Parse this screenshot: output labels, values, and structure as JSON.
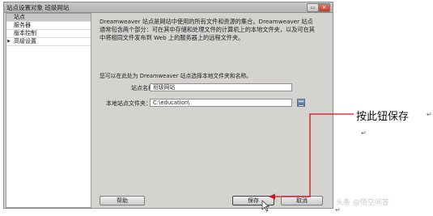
{
  "window": {
    "title": "站点设置对象 班级网站",
    "max_label": "▭",
    "close_label": "✕"
  },
  "sidebar": {
    "items": [
      {
        "label": "站点"
      },
      {
        "label": "服务器"
      },
      {
        "label": "版本控制"
      },
      {
        "label": "高级设置",
        "arrow": "▶"
      }
    ]
  },
  "content": {
    "description": "Dreamweaver 站点是网站中使用的所有文件和资源的集合。Dreamweaver 站点通常包含两个部分：可在其中存储和处理文件的计算机上的本地文件夹，以及可在其中将相同文件发布到 Web 上的服务器上的远程文件夹。",
    "prompt": "您可以在此处为 Dreamweaver 站点选择本地文件夹和名称。",
    "site_name_label": "站点名称：",
    "site_name_value": "班级网站",
    "local_folder_label": "本地站点文件夹：",
    "local_folder_value": "C:\\education\\"
  },
  "buttons": {
    "help": "帮助",
    "save": "保存",
    "cancel": "取消"
  },
  "annotation": {
    "text": "按此钮保存",
    "color": "#d0101a"
  },
  "watermark": "头条 @悟空问答",
  "paragraph_mark": "↵"
}
